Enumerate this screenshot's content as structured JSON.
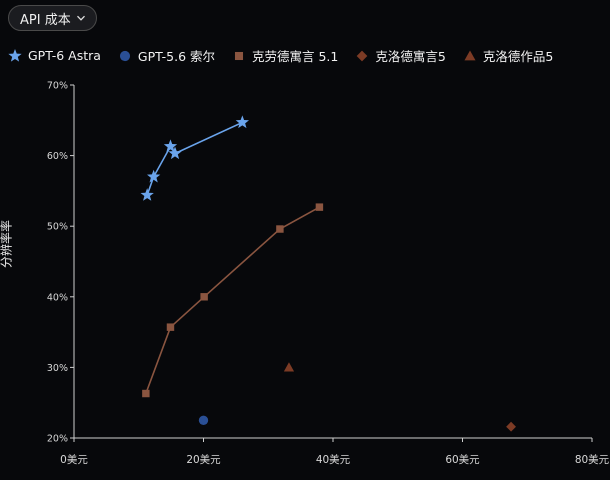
{
  "dropdown": {
    "label": "API 成本"
  },
  "chart_data": {
    "type": "scatter",
    "xlabel": "",
    "ylabel": "分辨率率",
    "xlim": [
      0,
      80
    ],
    "ylim": [
      20,
      70
    ],
    "x_ticks": [
      0,
      20,
      40,
      60,
      80
    ],
    "y_ticks": [
      20,
      30,
      40,
      50,
      60,
      70
    ],
    "x_tick_labels": [
      "0美元",
      "20美元",
      "40美元",
      "60美元",
      "80美元"
    ],
    "y_tick_labels": [
      "20%",
      "30%",
      "40%",
      "50%",
      "60%",
      "70%"
    ],
    "grid": false,
    "legend_position": "top",
    "series": [
      {
        "name": "GPT-6 Astra",
        "marker": "star",
        "color": "#6aa4ec",
        "connected": true,
        "points": [
          [
            11.3,
            54.4
          ],
          [
            12.3,
            57.0
          ],
          [
            14.9,
            61.3
          ],
          [
            15.6,
            60.3
          ],
          [
            26.0,
            64.7
          ]
        ]
      },
      {
        "name": "GPT-5.6 索尔",
        "marker": "circle",
        "color": "#2a4f95",
        "connected": false,
        "points": [
          [
            20.0,
            22.5
          ]
        ]
      },
      {
        "name": "克劳德寓言 5.1",
        "marker": "square",
        "color": "#8a5540",
        "connected": true,
        "points": [
          [
            11.1,
            26.3
          ],
          [
            14.9,
            35.7
          ],
          [
            20.1,
            40.0
          ],
          [
            31.8,
            49.6
          ],
          [
            37.9,
            52.7
          ]
        ]
      },
      {
        "name": "克洛德寓言5",
        "marker": "diamond",
        "color": "#7c3b25",
        "connected": false,
        "points": [
          [
            67.5,
            21.6
          ]
        ]
      },
      {
        "name": "克洛德作品5",
        "marker": "triangle",
        "color": "#7c3b25",
        "connected": false,
        "points": [
          [
            33.2,
            30.0
          ]
        ]
      }
    ]
  }
}
